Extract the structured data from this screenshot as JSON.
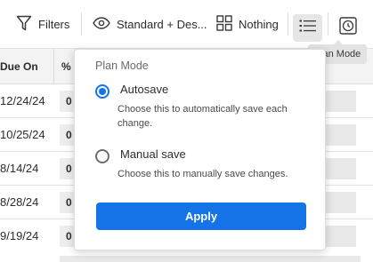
{
  "toolbar": {
    "filters_label": "Filters",
    "view_label": "Standard + Des...",
    "group_label": "Nothing",
    "icons": [
      "filter-icon",
      "eye-icon",
      "grid-icon",
      "list-icon",
      "clock-icon"
    ]
  },
  "tooltip": {
    "text": "Plan Mode"
  },
  "grid": {
    "columns": [
      "Due On",
      "%"
    ],
    "rows": [
      {
        "date": "12/24/24",
        "pct": "0"
      },
      {
        "date": "10/25/24",
        "pct": "0"
      },
      {
        "date": "8/14/24",
        "pct": "0"
      },
      {
        "date": "8/28/24",
        "pct": "0"
      },
      {
        "date": "9/19/24",
        "pct": "0"
      }
    ]
  },
  "popover": {
    "title": "Plan Mode",
    "options": [
      {
        "label": "Autosave",
        "description": "Choose this to automatically save each change.",
        "selected": true
      },
      {
        "label": "Manual save",
        "description": "Choose this to manually save changes.",
        "selected": false
      }
    ],
    "apply_label": "Apply"
  },
  "colors": {
    "accent": "#1473e6"
  }
}
